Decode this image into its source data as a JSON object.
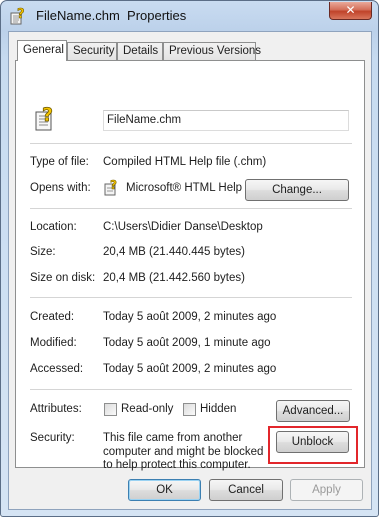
{
  "window": {
    "title_file": "FileName.chm",
    "title_suffix": "Properties",
    "close_glyph": "✕"
  },
  "tabs": [
    "General",
    "Security",
    "Details",
    "Previous Versions"
  ],
  "general": {
    "file_name": "FileName.chm",
    "rows": {
      "type_label": "Type of file:",
      "type_value": "Compiled HTML Help file (.chm)",
      "opens_label": "Opens with:",
      "opens_value": "Microsoft® HTML Help",
      "change_button": "Change...",
      "location_label": "Location:",
      "location_value": "C:\\Users\\Didier Danse\\Desktop",
      "size_label": "Size:",
      "size_value": "20,4 MB (21.440.445 bytes)",
      "size_disk_label": "Size on disk:",
      "size_disk_value": "20,4 MB (21.442.560 bytes)",
      "created_label": "Created:",
      "created_value": "Today 5 août 2009, 2 minutes ago",
      "modified_label": "Modified:",
      "modified_value": "Today 5 août 2009, 1 minute ago",
      "accessed_label": "Accessed:",
      "accessed_value": "Today 5 août 2009, 2 minutes ago",
      "attributes_label": "Attributes:",
      "readonly_label": "Read-only",
      "readonly_checked": false,
      "hidden_label": "Hidden",
      "hidden_checked": false,
      "advanced_button": "Advanced...",
      "security_label": "Security:",
      "security_text": "This file came from another computer and might be blocked to help protect this computer.",
      "unblock_button": "Unblock"
    }
  },
  "footer": {
    "ok": "OK",
    "cancel": "Cancel",
    "apply": "Apply"
  },
  "colors": {
    "highlight_box": "#e2262b",
    "title_bar": "#c9dcf1"
  },
  "icons": [
    "help-file-icon",
    "close-icon",
    "html-help-app-icon"
  ]
}
